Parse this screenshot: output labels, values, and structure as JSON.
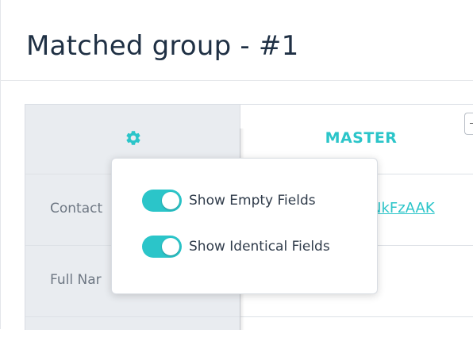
{
  "page": {
    "title": "Matched group - #1"
  },
  "table": {
    "settings_icon": "gear-icon",
    "master_label": "MASTER",
    "rows": [
      {
        "label": "Contact"
      },
      {
        "label": "Full Nar"
      }
    ],
    "master_record_link": "NkFzAAK"
  },
  "settings_popover": {
    "toggles": [
      {
        "label": "Show Empty Fields",
        "on": true
      },
      {
        "label": "Show Identical Fields",
        "on": true
      }
    ]
  },
  "colors": {
    "accent": "#2bc5c9",
    "label_column_bg": "#e9ecf0",
    "title": "#1f3044"
  }
}
